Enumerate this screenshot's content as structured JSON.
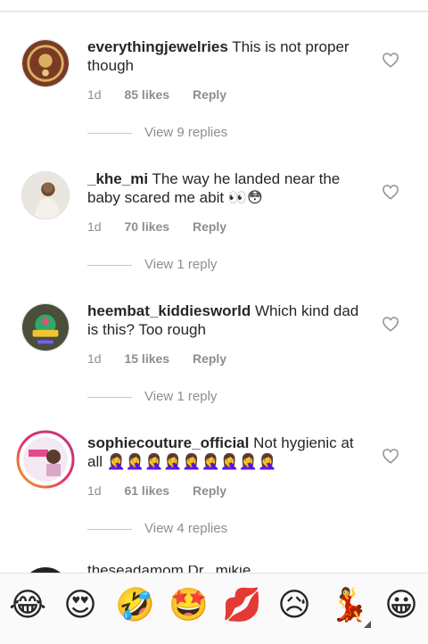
{
  "comments": [
    {
      "username": "everythingjewelries",
      "text": "This is not proper though",
      "age": "1d",
      "likes": "85 likes",
      "reply": "Reply",
      "view_replies": "View 9 replies"
    },
    {
      "username": "_khe_mi",
      "text": "The way he landed near the baby scared me abit 👀😳",
      "age": "1d",
      "likes": "70 likes",
      "reply": "Reply",
      "view_replies": "View 1 reply"
    },
    {
      "username": "heembat_kiddiesworld",
      "text": "Which kind dad is this? Too rough",
      "age": "1d",
      "likes": "15 likes",
      "reply": "Reply",
      "view_replies": "View 1 reply"
    },
    {
      "username": "sophiecouture_official",
      "text": "Not hygienic at all 🤦‍♀️🤦‍♀️🤦‍♀️🤦‍♀️🤦‍♀️🤦‍♀️🤦‍♀️🤦‍♀️🤦‍♀️",
      "age": "1d",
      "likes": "61 likes",
      "reply": "Reply",
      "view_replies": "View 4 replies"
    }
  ],
  "partial_comment": {
    "text": "theseadamom Dr...mikie..."
  },
  "emoji_bar": [
    "😂",
    "😍",
    "🤣",
    "🤩",
    "💋",
    "😥",
    "💃",
    "😀"
  ]
}
